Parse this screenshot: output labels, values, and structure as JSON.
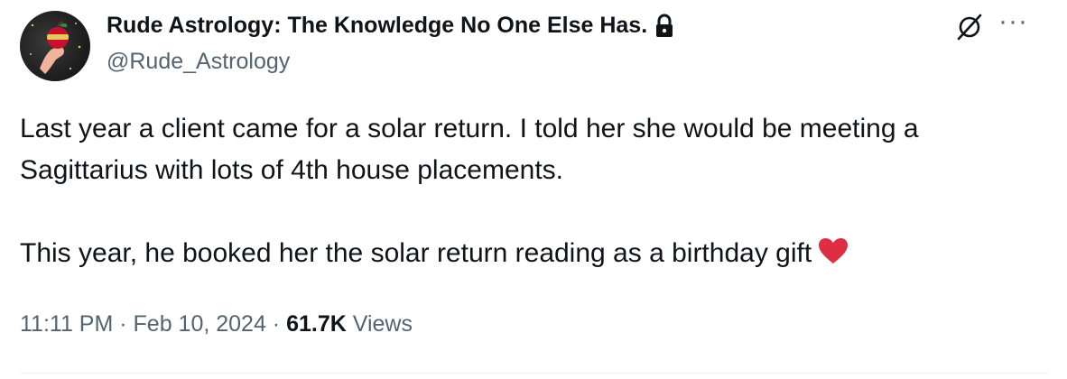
{
  "account": {
    "display_name": "Rude Astrology: The Knowledge No One Else Has.",
    "handle": "@Rude_Astrology",
    "protected_icon": "lock-icon",
    "avatar_icon": "hand-holding-apple-avatar"
  },
  "actions": {
    "grok_icon": "grok-icon",
    "more_label": "···"
  },
  "post": {
    "paragraph_1": "Last year a client came for a solar return. I told her she would be meeting a Sagittarius with lots of 4th house placements.",
    "paragraph_2": "This year, he booked her the solar return reading as a birthday gift",
    "emoji_icon": "red-heart-icon"
  },
  "meta": {
    "time": "11:11 PM",
    "sep1": " · ",
    "date": "Feb 10, 2024",
    "sep2": " · ",
    "views_count": "61.7K",
    "views_label": " Views"
  },
  "colors": {
    "text": "#0f1419",
    "secondary": "#536471",
    "heart": "#dd2e44"
  }
}
